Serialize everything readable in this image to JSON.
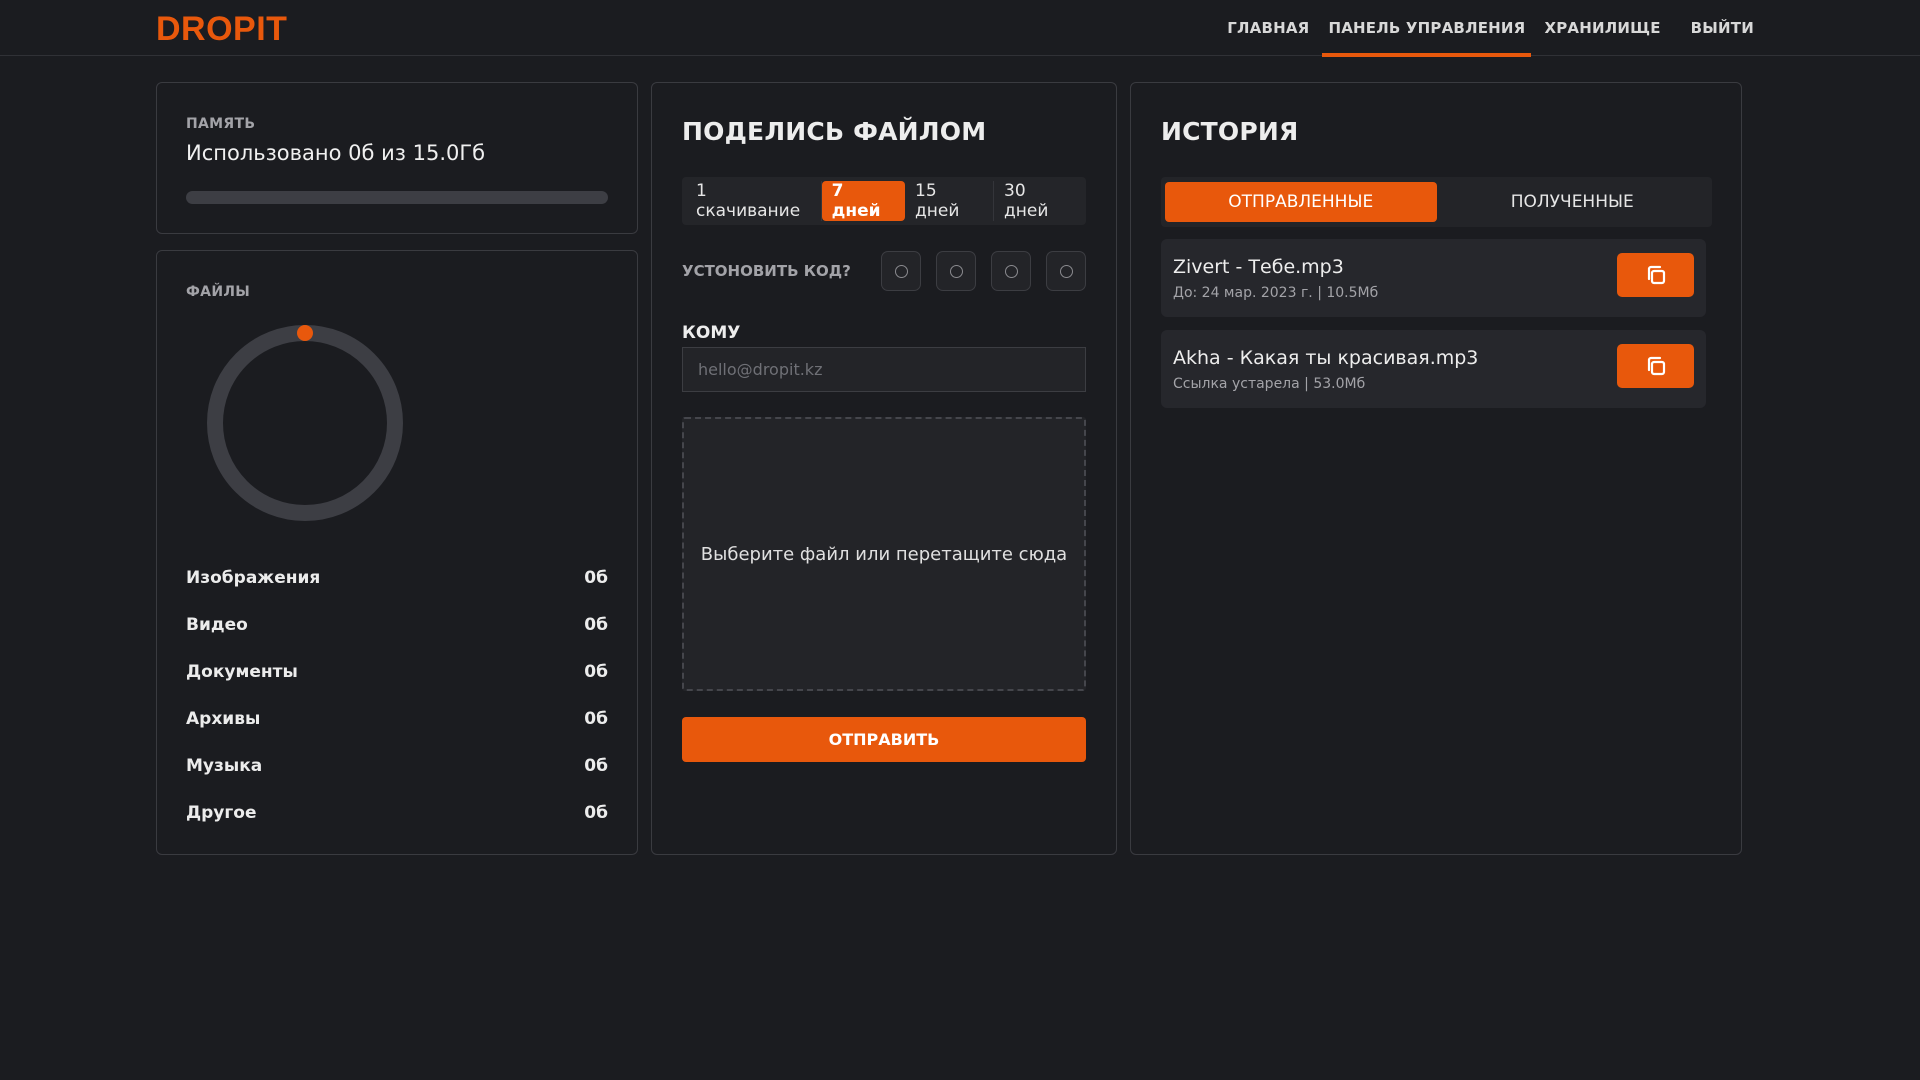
{
  "header": {
    "logo": "DROPIT",
    "nav": {
      "home": "ГЛАВНАЯ",
      "dashboard": "ПАНЕЛЬ УПРАВЛЕНИЯ",
      "storage": "ХРАНИЛИЩЕ",
      "logout": "ВЫЙТИ"
    },
    "active_nav": "ПАНЕЛЬ УПРАВЛЕНИЯ"
  },
  "memory": {
    "label": "ПАМЯТЬ",
    "used_text": "Использовано 0б из 15.0Гб",
    "used_fraction": 0
  },
  "files": {
    "label": "ФАЙЛЫ",
    "categories": [
      {
        "name": "Изображения",
        "size": "0б"
      },
      {
        "name": "Видео",
        "size": "0б"
      },
      {
        "name": "Документы",
        "size": "0б"
      },
      {
        "name": "Архивы",
        "size": "0б"
      },
      {
        "name": "Музыка",
        "size": "0б"
      },
      {
        "name": "Другое",
        "size": "0б"
      }
    ]
  },
  "share": {
    "title": "ПОДЕЛИСЬ ФАЙЛОМ",
    "durations": [
      "1 скачивание",
      "7 дней",
      "15 дней",
      "30 дней"
    ],
    "selected_duration": "7 дней",
    "code_label": "УСТОНОВИТЬ КОД?",
    "to_label": "КОМУ",
    "to_placeholder": "hello@dropit.kz",
    "to_value": "",
    "dropzone_text": "Выберите файл или перетащите сюда",
    "send_label": "ОТПРАВИТЬ"
  },
  "history": {
    "title": "ИСТОРИЯ",
    "tabs": [
      "ОТПРАВЛЕННЫЕ",
      "ПОЛУЧЕННЫЕ"
    ],
    "active_tab": "ОТПРАВЛЕННЫЕ",
    "items": [
      {
        "name": "Zivert - Тебе.mp3",
        "meta": "До: 24 мар. 2023 г. | 10.5Мб"
      },
      {
        "name": "Akha - Какая ты красивая.mp3",
        "meta": "Ссылка устарела | 53.0Мб"
      }
    ]
  },
  "colors": {
    "accent": "#e8580c",
    "background": "#1b1c20",
    "track": "#3d3e44"
  },
  "icons": {
    "copy": "copy-icon",
    "code_dot": "circle-outline-icon"
  }
}
